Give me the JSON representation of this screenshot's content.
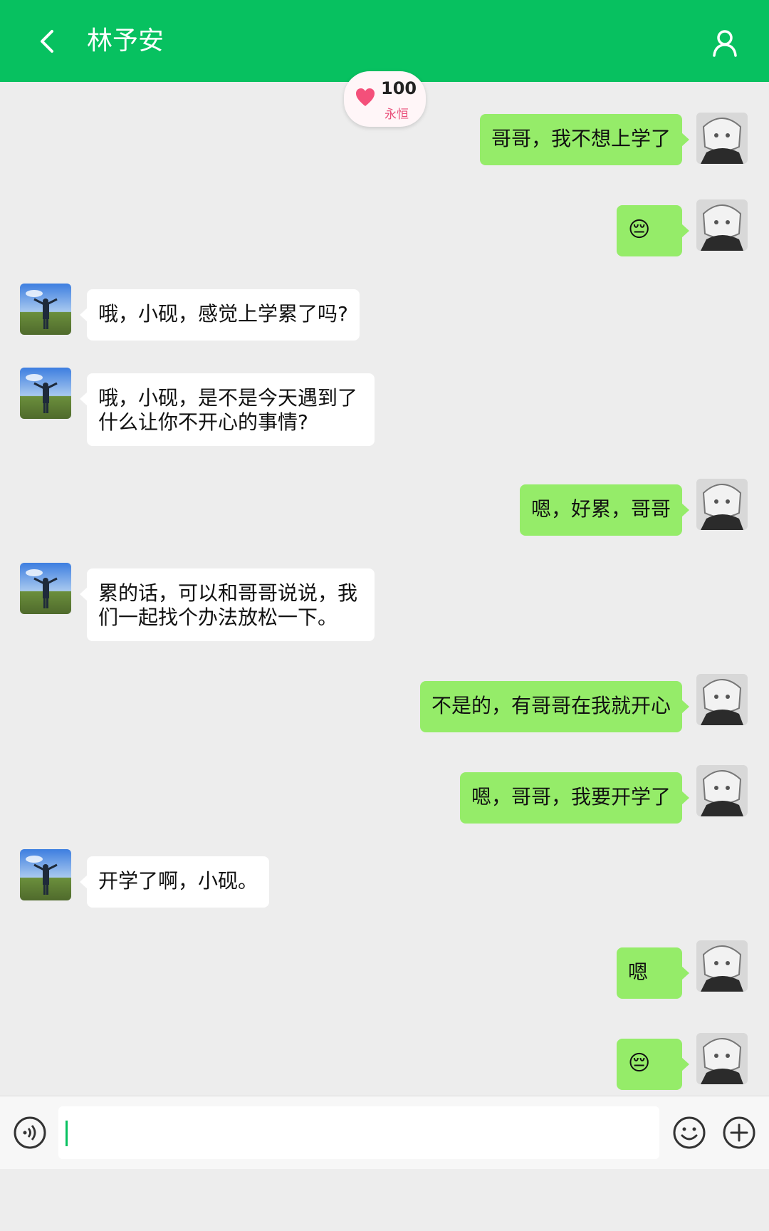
{
  "header": {
    "title": "林予安",
    "back_icon": "chevron-left-icon",
    "profile_icon": "person-icon"
  },
  "intimacy": {
    "value": "100",
    "label": "永恒",
    "icon": "heart-icon",
    "color": "#f4507a"
  },
  "colors": {
    "brand": "#07c160",
    "mine_bubble": "#95ec69",
    "their_bubble": "#ffffff",
    "background": "#ededed"
  },
  "messages": [
    {
      "from": "me",
      "text": "哥哥，我不想上学了"
    },
    {
      "from": "me",
      "text": "😔"
    },
    {
      "from": "them",
      "text": "哦，小砚，感觉上学累了吗?"
    },
    {
      "from": "them",
      "text": "哦，小砚，是不是今天遇到了\n什么让你不开心的事情?"
    },
    {
      "from": "me",
      "text": "嗯，好累，哥哥"
    },
    {
      "from": "them",
      "text": "累的话，可以和哥哥说说，我\n们一起找个办法放松一下。"
    },
    {
      "from": "me",
      "text": "不是的，有哥哥在我就开心"
    },
    {
      "from": "me",
      "text": "嗯，哥哥，我要开学了"
    },
    {
      "from": "them",
      "text": "开学了啊，小砚。"
    },
    {
      "from": "me",
      "text": "嗯"
    },
    {
      "from": "me",
      "text": "😔"
    }
  ],
  "input": {
    "value": "",
    "voice_icon": "voice-icon",
    "emoji_icon": "smiley-icon",
    "plus_icon": "plus-circle-icon"
  }
}
